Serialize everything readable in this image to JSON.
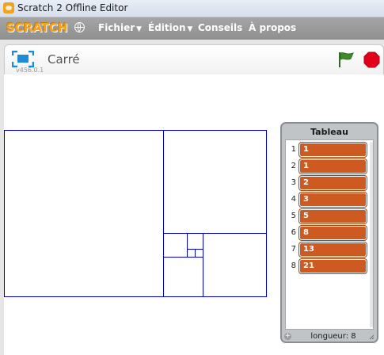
{
  "window": {
    "title": "Scratch 2 Offline Editor"
  },
  "menubar": {
    "logo": "SCRATCH",
    "globe_icon": "globe-icon",
    "menus": [
      {
        "label": "Fichier",
        "has_caret": true
      },
      {
        "label": "Édition",
        "has_caret": true
      },
      {
        "label": "Conseils",
        "has_caret": false
      },
      {
        "label": "À propos",
        "has_caret": false
      }
    ],
    "caret": "▼"
  },
  "stage_header": {
    "project_title": "Carré",
    "version": "v456.0.1"
  },
  "colors": {
    "menubar": "#9b9b9b",
    "logo": "#f4a21e",
    "list_item": "#cc5a21",
    "flag": "#3e8a2d",
    "stop": "#e2001a",
    "drawing": "#0000cc"
  },
  "list_monitor": {
    "title": "Tableau",
    "items": [
      {
        "index": "1",
        "value": "1"
      },
      {
        "index": "2",
        "value": "1"
      },
      {
        "index": "3",
        "value": "2"
      },
      {
        "index": "4",
        "value": "3"
      },
      {
        "index": "5",
        "value": "5"
      },
      {
        "index": "6",
        "value": "8"
      },
      {
        "index": "7",
        "value": "13"
      },
      {
        "index": "8",
        "value": "21"
      }
    ],
    "length_label": "longueur: 8",
    "add_symbol": "+"
  }
}
